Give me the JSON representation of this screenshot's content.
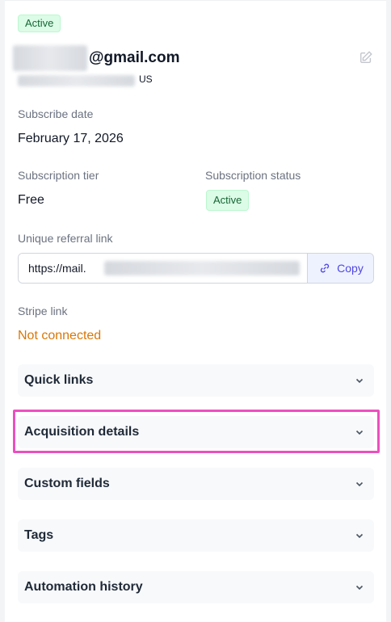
{
  "header": {
    "status_badge": "Active",
    "email_domain": "@gmail.com",
    "country": "US",
    "edit_icon": "edit-icon"
  },
  "fields": {
    "subscribe_date_label": "Subscribe date",
    "subscribe_date_value": "February 17, 2026",
    "tier_label": "Subscription tier",
    "tier_value": "Free",
    "status_label": "Subscription status",
    "status_value": "Active",
    "referral_label": "Unique referral link",
    "referral_value": "https://mail.",
    "copy_label": "Copy",
    "copy_icon": "link-icon",
    "stripe_label": "Stripe link",
    "stripe_value": "Not connected"
  },
  "accordions": [
    {
      "title": "Quick links"
    },
    {
      "title": "Acquisition details"
    },
    {
      "title": "Custom fields"
    },
    {
      "title": "Tags"
    },
    {
      "title": "Automation history"
    }
  ],
  "colors": {
    "accent": "#4f46e5",
    "success_bg": "#dcfce7",
    "success_text": "#166534",
    "warning_text": "#d97706",
    "highlight": "#ec4fc0"
  }
}
